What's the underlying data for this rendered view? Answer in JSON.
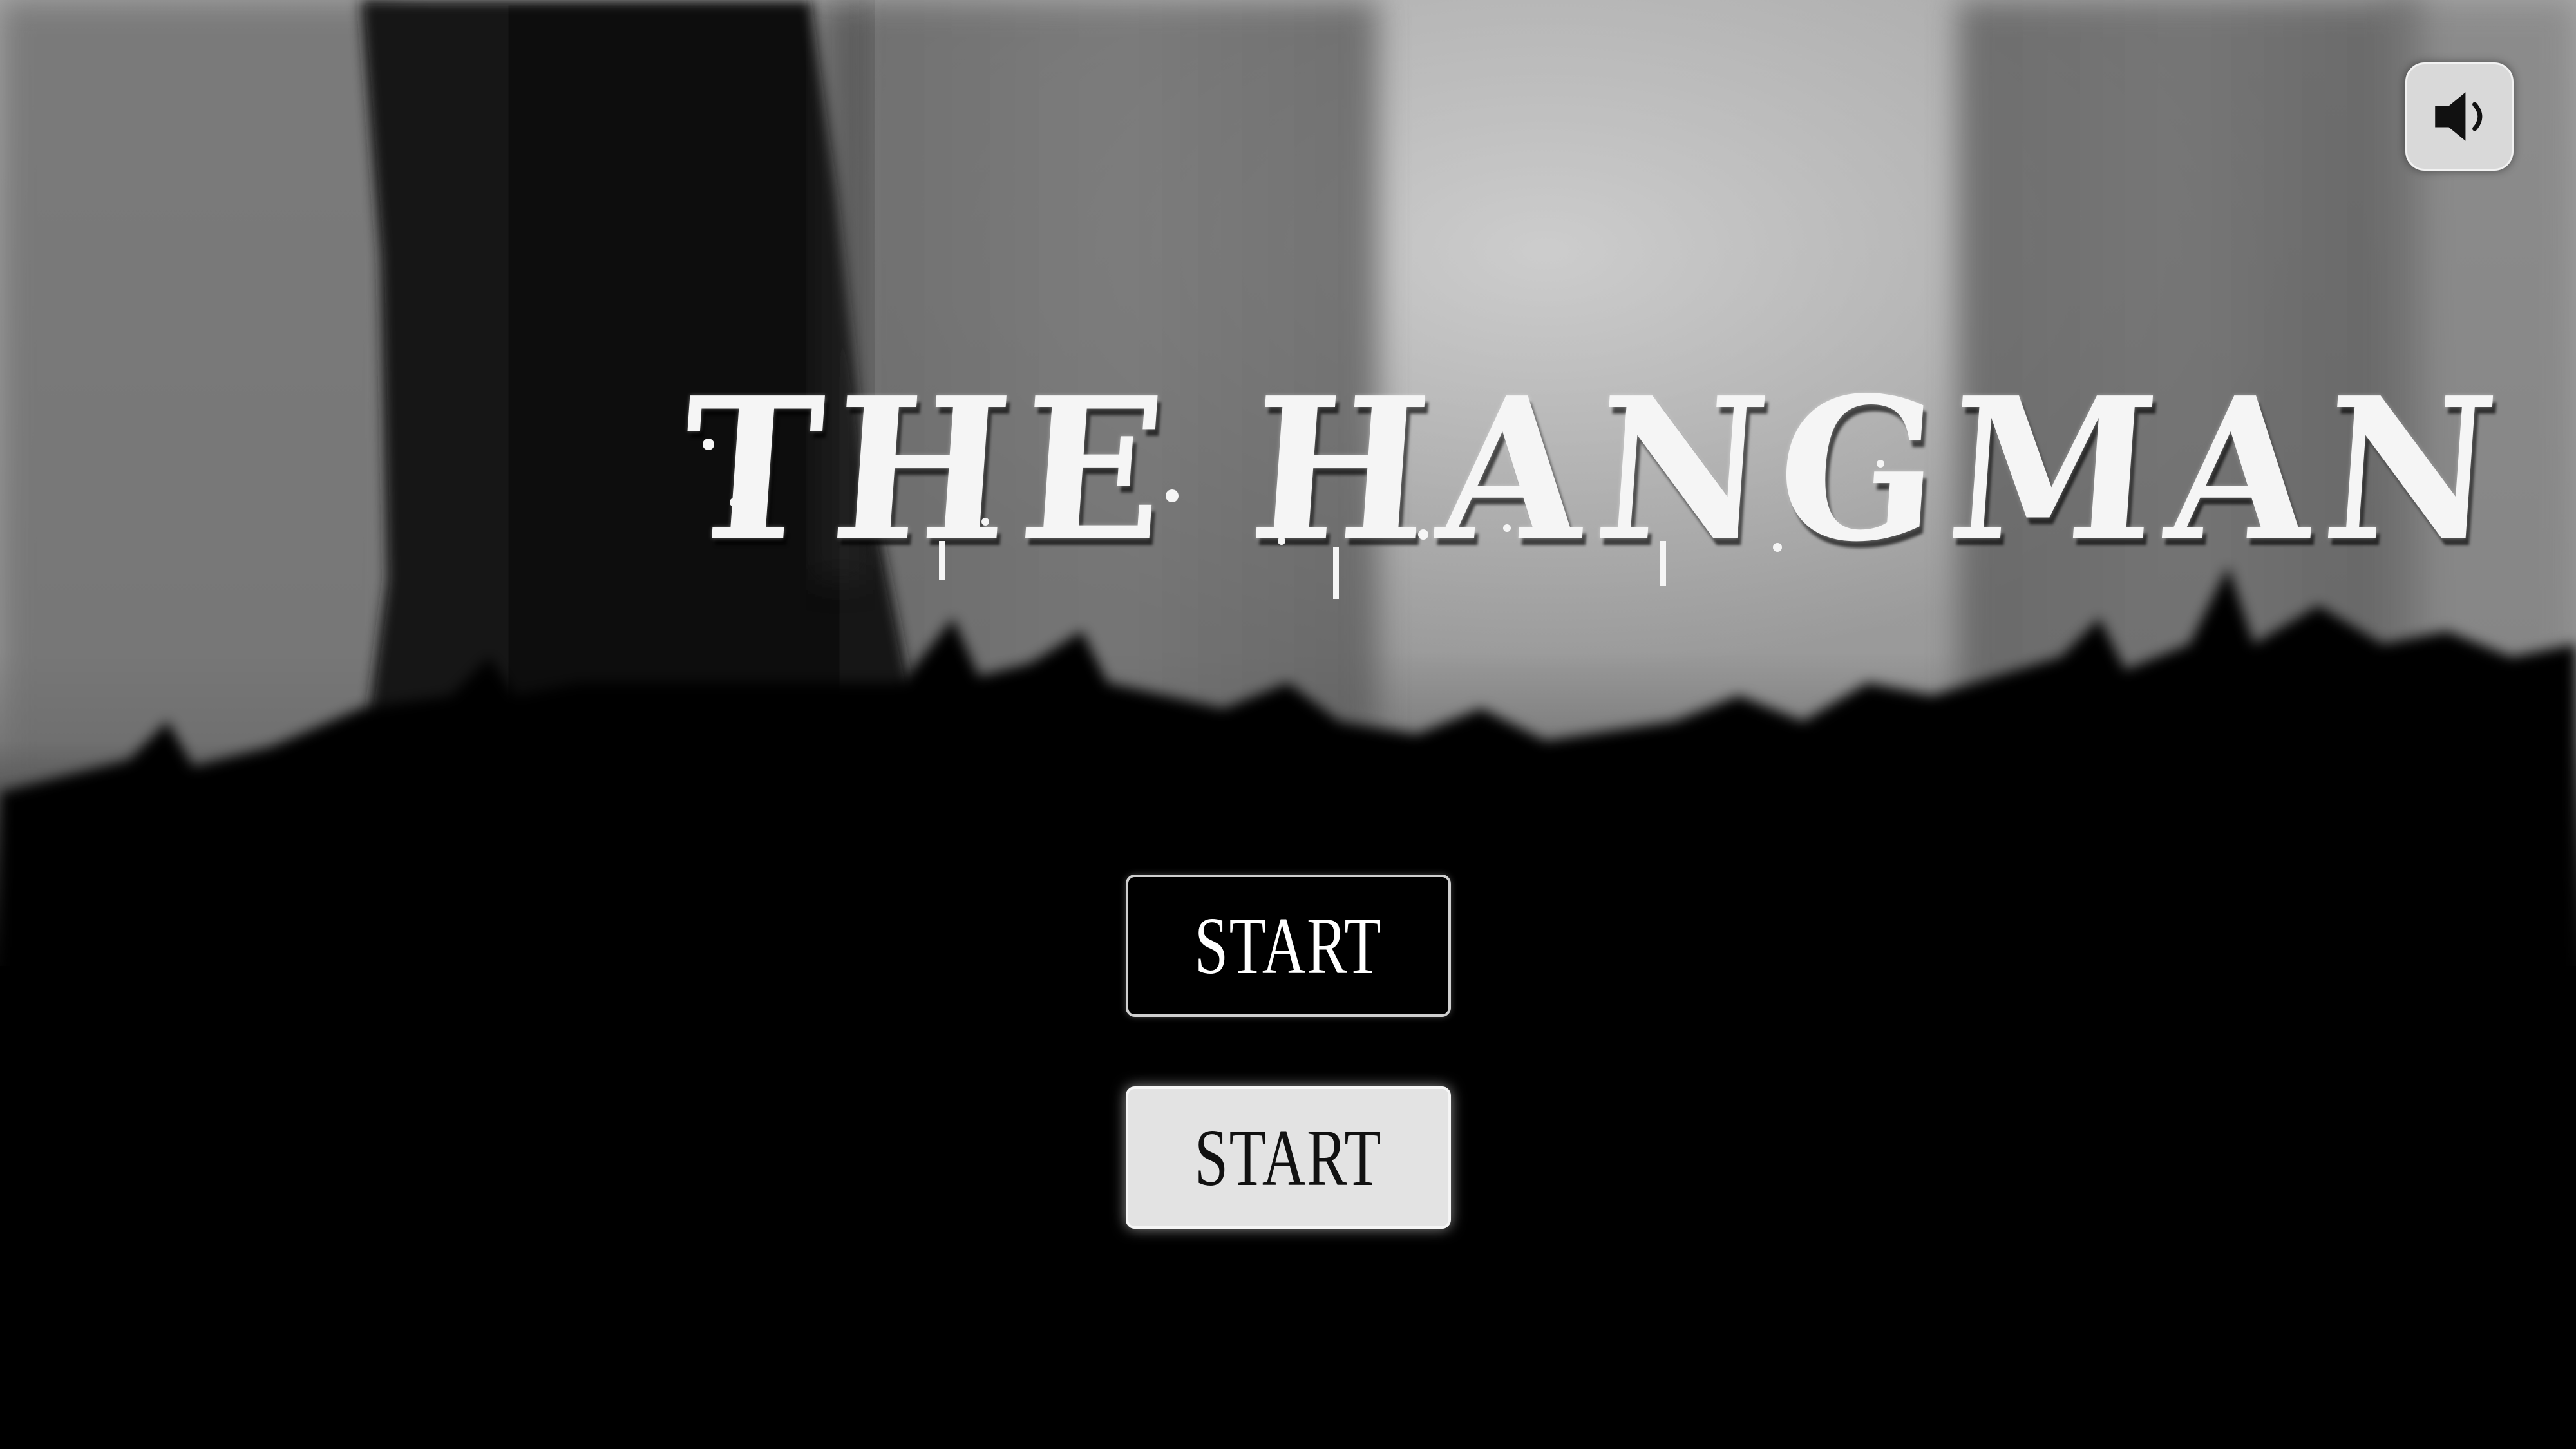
{
  "game": {
    "title": "THE HANGMAN"
  },
  "menu": {
    "start_primary_label": "START",
    "start_secondary_label": "START"
  },
  "controls": {
    "sound_icon": "speaker-icon"
  },
  "colors": {
    "sky": "#b0b0b0",
    "ground": "#000000",
    "title": "#f5f5f5",
    "button_light": "#e3e3e3"
  }
}
